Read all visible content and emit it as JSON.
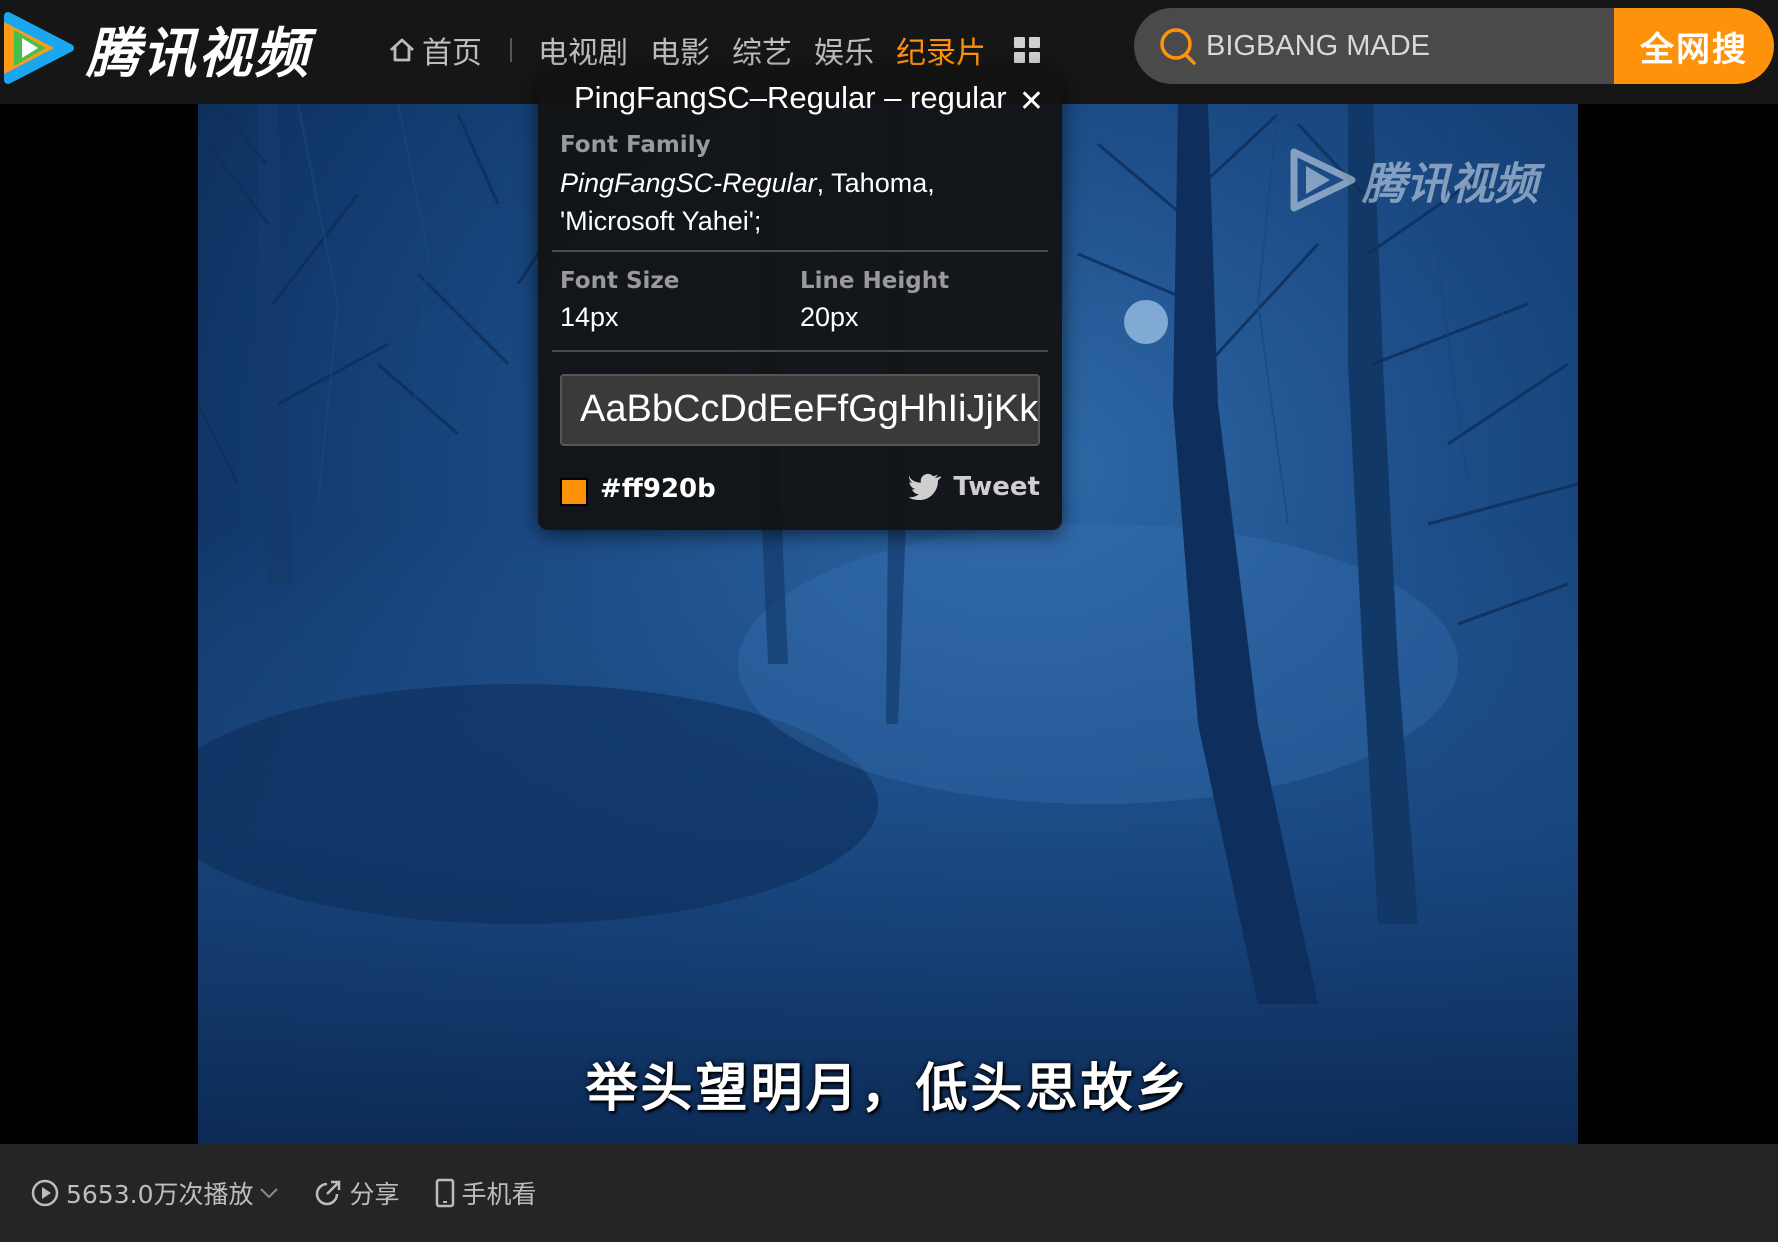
{
  "header": {
    "logo_text": "腾讯视频",
    "nav": {
      "home": "首页",
      "items": [
        "电视剧",
        "电影",
        "综艺",
        "娱乐",
        "纪录片"
      ],
      "active_index": 4
    },
    "search": {
      "value": "BIGBANG MADE",
      "button": "全网搜"
    }
  },
  "video": {
    "watermark": "腾讯视频",
    "subtitle": "举头望明月，低头思故乡"
  },
  "footer": {
    "plays": "5653.0万次播放",
    "share": "分享",
    "mobile": "手机看"
  },
  "font_popup": {
    "title": "PingFangSC–Regular – regular",
    "family_label": "Font Family",
    "family_first": "PingFangSC-Regular",
    "family_rest": ", Tahoma,",
    "family_line2": "'Microsoft Yahei';",
    "size_label": "Font Size",
    "size_value": "14px",
    "lineheight_label": "Line Height",
    "lineheight_value": "20px",
    "sample": "AaBbCcDdEeFfGgHhIiJjKkLlMm",
    "color_hex": "#ff920b",
    "tweet": "Tweet"
  },
  "colors": {
    "accent": "#ff920b",
    "topbar": "#161616",
    "bottombar": "#252525"
  },
  "icons": [
    "play-logo-icon",
    "home-icon",
    "grid-icon",
    "search-icon",
    "close-icon",
    "twitter-bird-icon",
    "play-count-icon",
    "chevron-down-icon",
    "share-icon",
    "phone-icon"
  ]
}
